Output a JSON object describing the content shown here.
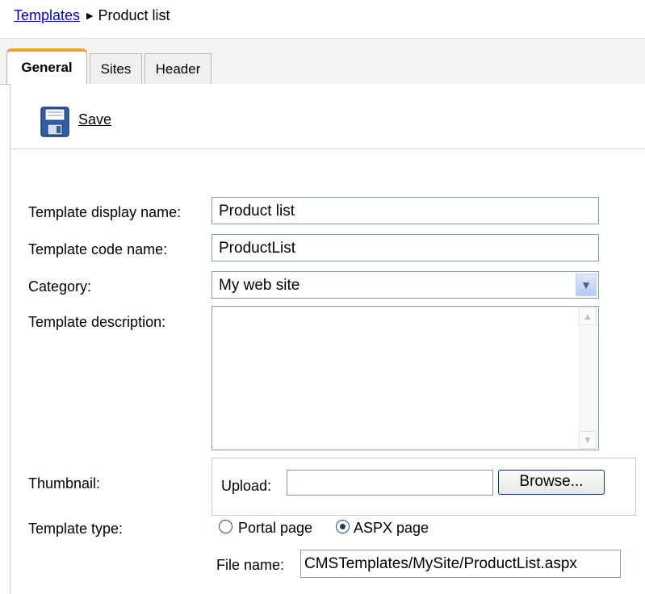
{
  "breadcrumb": {
    "link": "Templates",
    "current": "Product list"
  },
  "tabs": [
    {
      "label": "General",
      "active": true
    },
    {
      "label": "Sites",
      "active": false
    },
    {
      "label": "Header",
      "active": false
    }
  ],
  "toolbar": {
    "save_label": "Save",
    "icon": "floppy-disk-icon"
  },
  "form": {
    "display_name": {
      "label": "Template display name:",
      "value": "Product list"
    },
    "code_name": {
      "label": "Template code name:",
      "value": "ProductList"
    },
    "category": {
      "label": "Category:",
      "value": "My web site"
    },
    "description": {
      "label": "Template description:",
      "value": ""
    },
    "thumbnail": {
      "label": "Thumbnail:",
      "upload_label": "Upload:",
      "upload_value": "",
      "browse_label": "Browse..."
    },
    "template_type": {
      "label": "Template type:",
      "options": [
        {
          "label": "Portal page",
          "selected": false
        },
        {
          "label": "ASPX page",
          "selected": true
        }
      ]
    },
    "file_name": {
      "label": "File name:",
      "value": "CMSTemplates/MySite/ProductList.aspx"
    }
  },
  "colors": {
    "accent_tab": "#f0a030",
    "link": "#0000cc",
    "input_border": "#7f9db9"
  }
}
